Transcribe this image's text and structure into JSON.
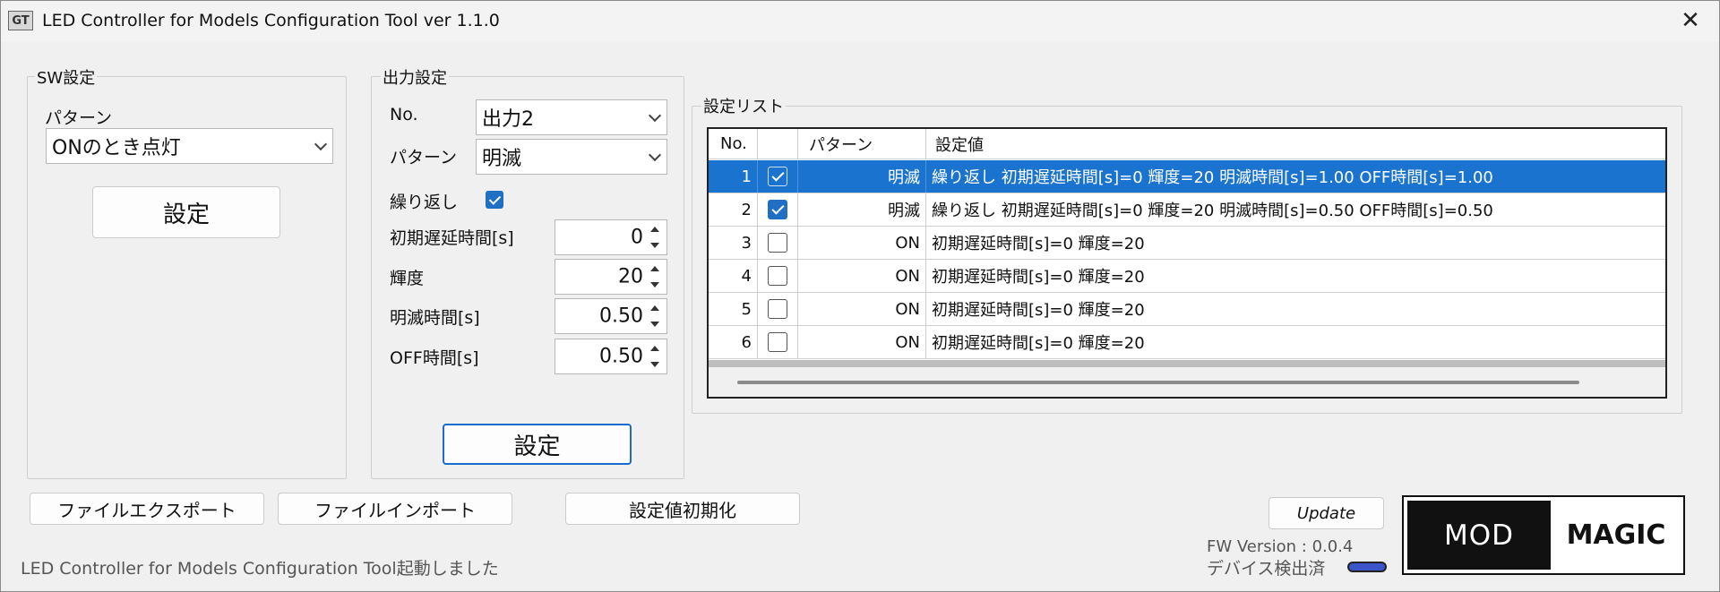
{
  "window": {
    "title": "LED Controller for Models Configuration Tool ver 1.1.0",
    "app_icon": "GT"
  },
  "sw": {
    "group_title": "SW設定",
    "pattern_label": "パターン",
    "pattern_value": "ONのとき点灯",
    "set_button": "設定"
  },
  "output": {
    "group_title": "出力設定",
    "no_label": "No.",
    "no_value": "出力2",
    "pattern_label": "パターン",
    "pattern_value": "明滅",
    "repeat_label": "繰り返し",
    "repeat_checked": true,
    "delay_label": "初期遅延時間[s]",
    "delay_value": "0",
    "brightness_label": "輝度",
    "brightness_value": "20",
    "blink_label": "明滅時間[s]",
    "blink_value": "0.50",
    "off_label": "OFF時間[s]",
    "off_value": "0.50",
    "set_button": "設定"
  },
  "list": {
    "group_title": "設定リスト",
    "headers": {
      "no": "No.",
      "check": "",
      "pattern": "パターン",
      "value": "設定値"
    },
    "rows": [
      {
        "no": "1",
        "checked": true,
        "pattern": "明滅",
        "value": "繰り返し 初期遅延時間[s]=0 輝度=20 明滅時間[s]=1.00 OFF時間[s]=1.00",
        "selected": true
      },
      {
        "no": "2",
        "checked": true,
        "pattern": "明滅",
        "value": "繰り返し 初期遅延時間[s]=0 輝度=20 明滅時間[s]=0.50 OFF時間[s]=0.50",
        "selected": false
      },
      {
        "no": "3",
        "checked": false,
        "pattern": "ON",
        "value": "初期遅延時間[s]=0 輝度=20",
        "selected": false
      },
      {
        "no": "4",
        "checked": false,
        "pattern": "ON",
        "value": "初期遅延時間[s]=0 輝度=20",
        "selected": false
      },
      {
        "no": "5",
        "checked": false,
        "pattern": "ON",
        "value": "初期遅延時間[s]=0 輝度=20",
        "selected": false
      },
      {
        "no": "6",
        "checked": false,
        "pattern": "ON",
        "value": "初期遅延時間[s]=0 輝度=20",
        "selected": false
      }
    ]
  },
  "footer": {
    "export_button": "ファイルエクスポート",
    "import_button": "ファイルインポート",
    "reset_button": "設定値初期化",
    "update_button": "Update",
    "fw_version": "FW Version : 0.0.4",
    "device_status": "デバイス検出済",
    "status_message": "LED Controller for Models Configuration Tool起動しました"
  },
  "logo": {
    "left": "MOD",
    "right": "MAGIC"
  },
  "colors": {
    "selection": "#1a73cf",
    "accent": "#1f6fc4"
  }
}
